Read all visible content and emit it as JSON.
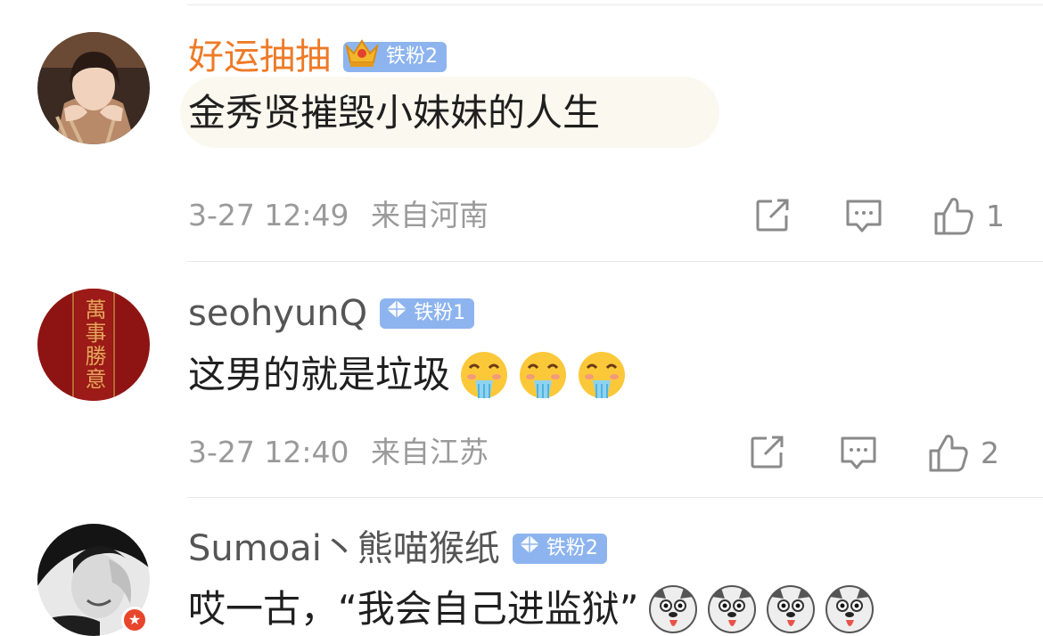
{
  "comments": [
    {
      "username": "好运抽抽",
      "badge": "铁粉2",
      "text": "金秀贤摧毁小妹妹的人生",
      "time": "3-27 12:49",
      "location": "来自河南",
      "likes": "1",
      "emojis": []
    },
    {
      "username": "seohyunQ",
      "badge": "铁粉1",
      "text": "这男的就是垃圾",
      "time": "3-27 12:40",
      "location": "来自江苏",
      "likes": "2",
      "emojis": [
        "drooling-face-emoji",
        "drooling-face-emoji",
        "drooling-face-emoji"
      ]
    },
    {
      "username": "Sumoai丶熊喵猴纸",
      "badge": "铁粉2",
      "text": "哎一古，“我会自己进监狱”",
      "emojis": [
        "husky-dog-emoji",
        "husky-dog-emoji",
        "husky-dog-emoji",
        "husky-dog-emoji"
      ]
    }
  ],
  "avatar2_text": "萬事勝意",
  "colors": {
    "username_highlight": "#ee7a27",
    "username_default": "#555555",
    "badge": "#8db4ee",
    "meta": "#9a9a9a"
  },
  "icons": [
    "share-icon",
    "comment-icon",
    "like-icon",
    "fan-badge-gem-icon",
    "fan-badge-crown-icon"
  ]
}
